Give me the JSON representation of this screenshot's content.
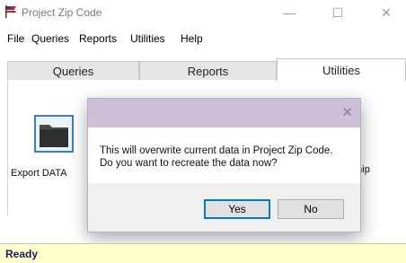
{
  "window": {
    "title": "Project Zip Code",
    "minimize_glyph": "—",
    "maximize_glyph": "☐",
    "close_glyph": "✕"
  },
  "menu": {
    "items": [
      "File",
      "Queries",
      "Reports",
      "Utilities",
      "Help"
    ]
  },
  "tabs": [
    {
      "label": "Queries",
      "active": false
    },
    {
      "label": "Reports",
      "active": false
    },
    {
      "label": "Utilities",
      "active": true
    }
  ],
  "panel": {
    "export_label": "Export DATA",
    "partial_label": "rship",
    "icons": [
      "folder-icon"
    ]
  },
  "dialog": {
    "message_line1": "This will overwrite current data in Project Zip Code.",
    "message_line2": "Do you want to recreate the data now?",
    "close_glyph": "✕",
    "yes_label": "Yes",
    "no_label": "No"
  },
  "status": {
    "text": "Ready"
  },
  "colors": {
    "dialog_title_bg": "#cdbfd8",
    "status_bg": "#ffffcc",
    "accent": "#0078d7"
  }
}
